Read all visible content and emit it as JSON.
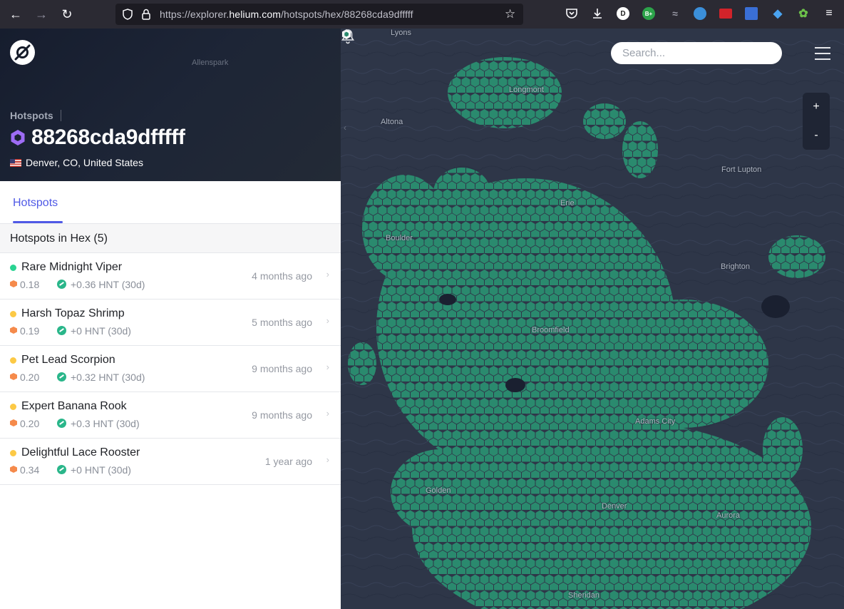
{
  "browser": {
    "url_prefix": "https://explorer.",
    "url_domain": "helium.com",
    "url_path": "/hotspots/hex/88268cda9dfffff",
    "ext_d_label": "D",
    "ext_b_label": "B+"
  },
  "hero": {
    "map_label": "Allenspark",
    "breadcrumb": "Hotspots",
    "title": "88268cda9dfffff",
    "location": "Denver, CO, United States"
  },
  "tabs": [
    {
      "label": "Hotspots",
      "active": true
    }
  ],
  "section_header": "Hotspots in Hex (5)",
  "hotspots": [
    {
      "name": "Rare Midnight Viper",
      "status_color": "#29d391",
      "scale": "0.18",
      "reward": "+0.36 HNT (30d)",
      "time": "4 months ago"
    },
    {
      "name": "Harsh Topaz Shrimp",
      "status_color": "#fcc945",
      "scale": "0.19",
      "reward": "+0 HNT (30d)",
      "time": "5 months ago"
    },
    {
      "name": "Pet Lead Scorpion",
      "status_color": "#fcc945",
      "scale": "0.20",
      "reward": "+0.32 HNT (30d)",
      "time": "9 months ago"
    },
    {
      "name": "Expert Banana Rook",
      "status_color": "#fcc945",
      "scale": "0.20",
      "reward": "+0.3 HNT (30d)",
      "time": "9 months ago"
    },
    {
      "name": "Delightful Lace Rooster",
      "status_color": "#fcc945",
      "scale": "0.34",
      "reward": "+0 HNT (30d)",
      "time": "1 year ago"
    }
  ],
  "map": {
    "search_placeholder": "Search...",
    "zoom_in": "+",
    "zoom_out": "-",
    "labels": [
      "Lyons",
      "Longmont",
      "Altona",
      "Fort Lupton",
      "Erie",
      "Boulder",
      "Brighton",
      "Broomfield",
      "Adams City",
      "Golden",
      "Denver",
      "Aurora",
      "Sheridan"
    ]
  },
  "colors": {
    "accent": "#4f59e6",
    "hex_coverage": "#2a8a6e",
    "scale_orange": "#f58a4b",
    "hnt_green": "#2ab68a"
  }
}
